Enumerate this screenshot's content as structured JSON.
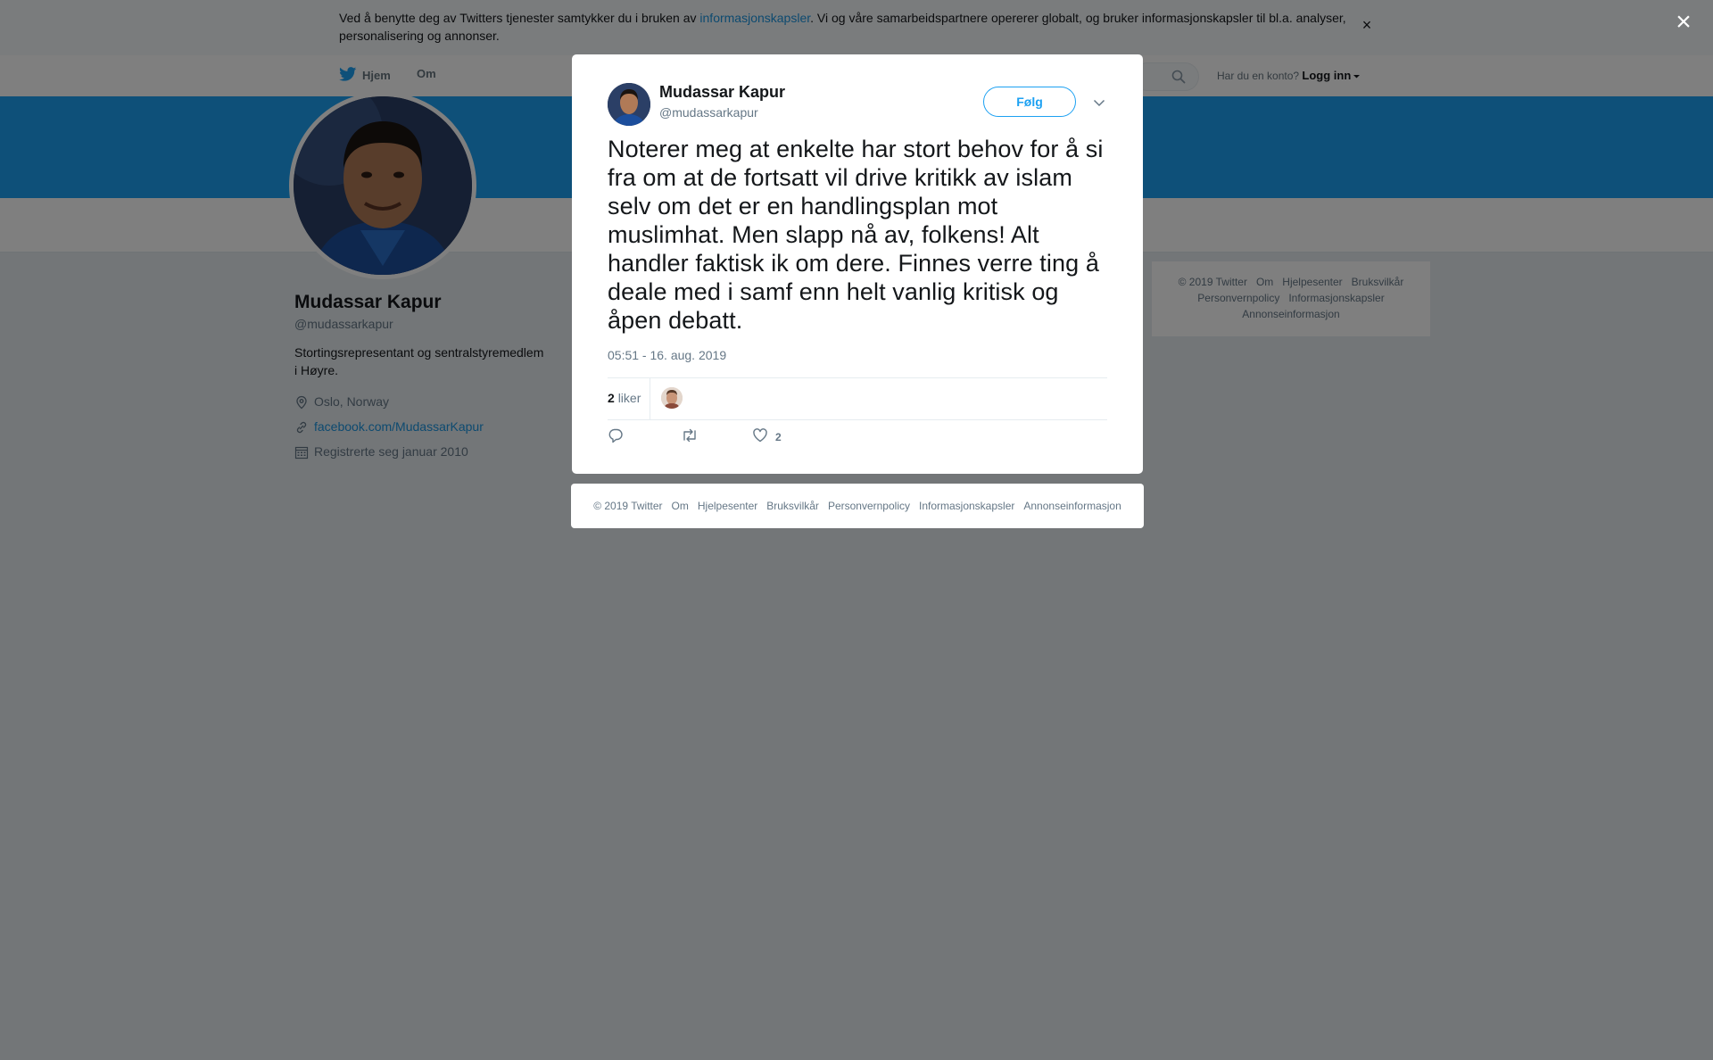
{
  "cookie_banner": {
    "text_before": "Ved å benytte deg av Twitters tjenester samtykker du i bruken av ",
    "link": "informasjonskapsler",
    "text_after": ". Vi og våre samarbeidspartnere opererer globalt, og bruker informasjonskapsler til bl.a. analyser, personalisering og annonser.",
    "close": "×"
  },
  "nav": {
    "home": "Hjem",
    "about": "Om",
    "account_prompt": "Har du en konto?",
    "login": "Logg inn"
  },
  "profile": {
    "name": "Mudassar Kapur",
    "handle": "@mudassarkapur",
    "bio": "Stortingsrepresentant og sentralstyremedlem i Høyre.",
    "location": "Oslo, Norway",
    "url": "facebook.com/MudassarKapur",
    "joined": "Registrerte seg januar 2010"
  },
  "sidebar_footer": {
    "items": [
      "© 2019 Twitter",
      "Om",
      "Hjelpesenter",
      "Bruksvilkår",
      "Personvernpolicy",
      "Informasjonskapsler",
      "Annonseinformasjon"
    ]
  },
  "overlay": {
    "close": "×"
  },
  "tweet": {
    "author_name": "Mudassar Kapur",
    "author_handle": "@mudassarkapur",
    "follow_label": "Følg",
    "text": "Noterer meg at enkelte har stort behov for å si fra om at de fortsatt vil drive kritikk av islam selv om det er en handlingsplan mot muslimhat. Men slapp nå av, folkens! Alt handler faktisk ik om dere. Finnes verre ting å deale med i samf enn helt vanlig kritisk og åpen debatt.",
    "timestamp": "05:51 - 16. aug. 2019",
    "likes_count": "2",
    "likes_label": "liker",
    "like_action_count": "2"
  },
  "modal_footer": {
    "items": [
      "© 2019 Twitter",
      "Om",
      "Hjelpesenter",
      "Bruksvilkår",
      "Personvernpolicy",
      "Informasjonskapsler",
      "Annonseinformasjon"
    ]
  },
  "colors": {
    "brand_blue": "#1da1f2",
    "link_blue": "#1b95e0",
    "text_primary": "#14171a",
    "text_secondary": "#657786"
  },
  "icons": [
    "twitter-bird-icon",
    "search-icon",
    "caret-down-icon",
    "location-pin-icon",
    "link-icon",
    "calendar-icon",
    "close-icon",
    "chevron-down-icon",
    "reply-icon",
    "retweet-icon",
    "heart-icon"
  ]
}
